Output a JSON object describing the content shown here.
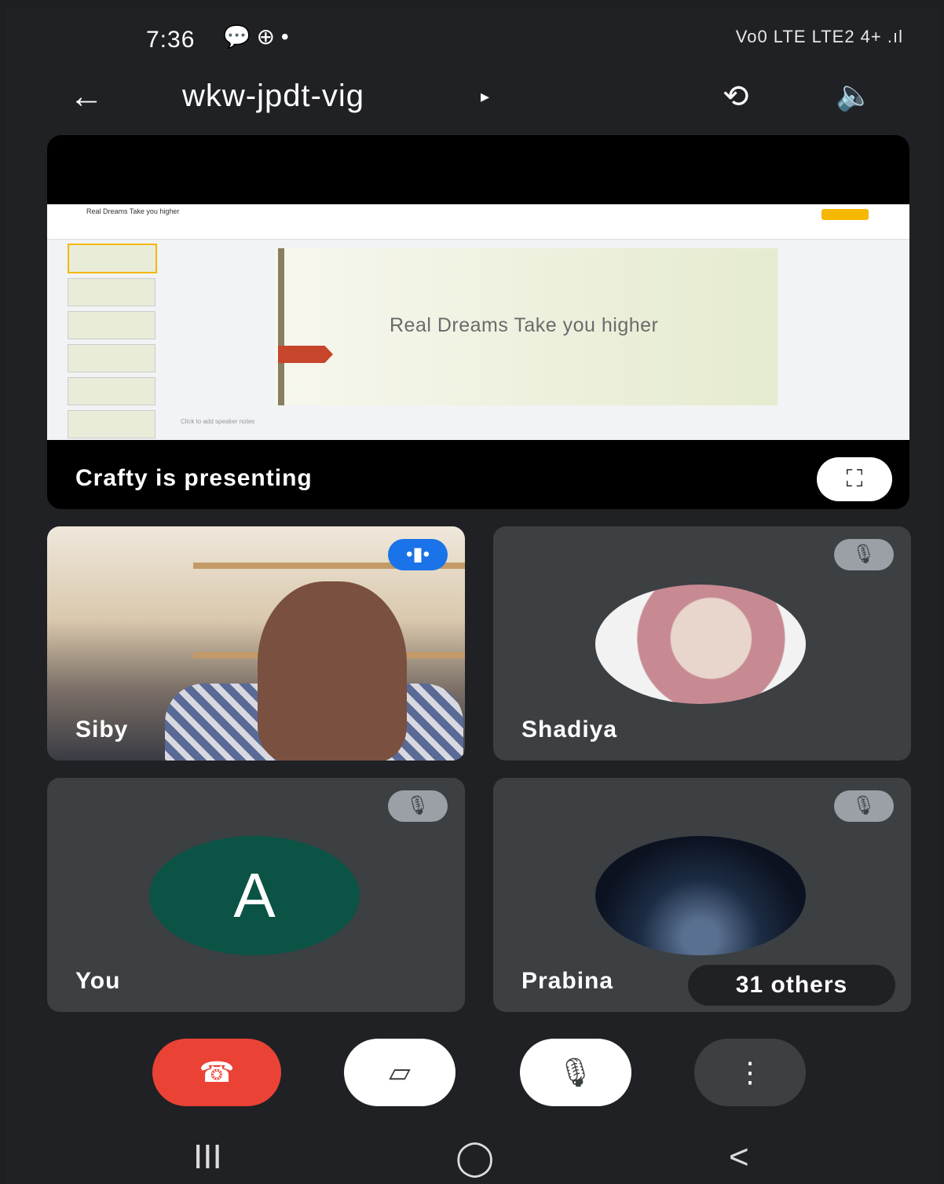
{
  "status_bar": {
    "time": "7:36",
    "left_icons": "💬 ⊕ •",
    "right_icons": "Vo0 LTE LTE2 4+ .ıl"
  },
  "header": {
    "back_icon": "←",
    "meeting_code": "wkw-jpdt-vig",
    "meeting_arrow": "▸",
    "camera_switch_icon": "⟲",
    "speaker_icon": "🔈"
  },
  "presentation": {
    "slide_title": "Real Dreams Take you higher",
    "doc_title": "Real Dreams Take you higher",
    "speaker_notes": "Click to add speaker notes",
    "caption": "Crafty is presenting",
    "fullscreen_icon": "⛶"
  },
  "participants": [
    {
      "name": "Siby",
      "speaking": true
    },
    {
      "name": "Shadiya",
      "muted": true
    },
    {
      "name": "You",
      "initial": "A",
      "muted": true
    },
    {
      "name": "Prabina",
      "muted": true
    }
  ],
  "others_count": "31 others",
  "controls": {
    "end_call_icon": "☎",
    "camera_icon": "▱",
    "mic_icon": "🎙",
    "more_icon": "⋮"
  },
  "nav": {
    "recents": "III",
    "home": "◯",
    "back": "<"
  },
  "colors": {
    "end_call": "#ea4335",
    "tile_bg": "#3c4043",
    "speaking": "#1a73e8",
    "avatar_you": "#0b5345"
  }
}
